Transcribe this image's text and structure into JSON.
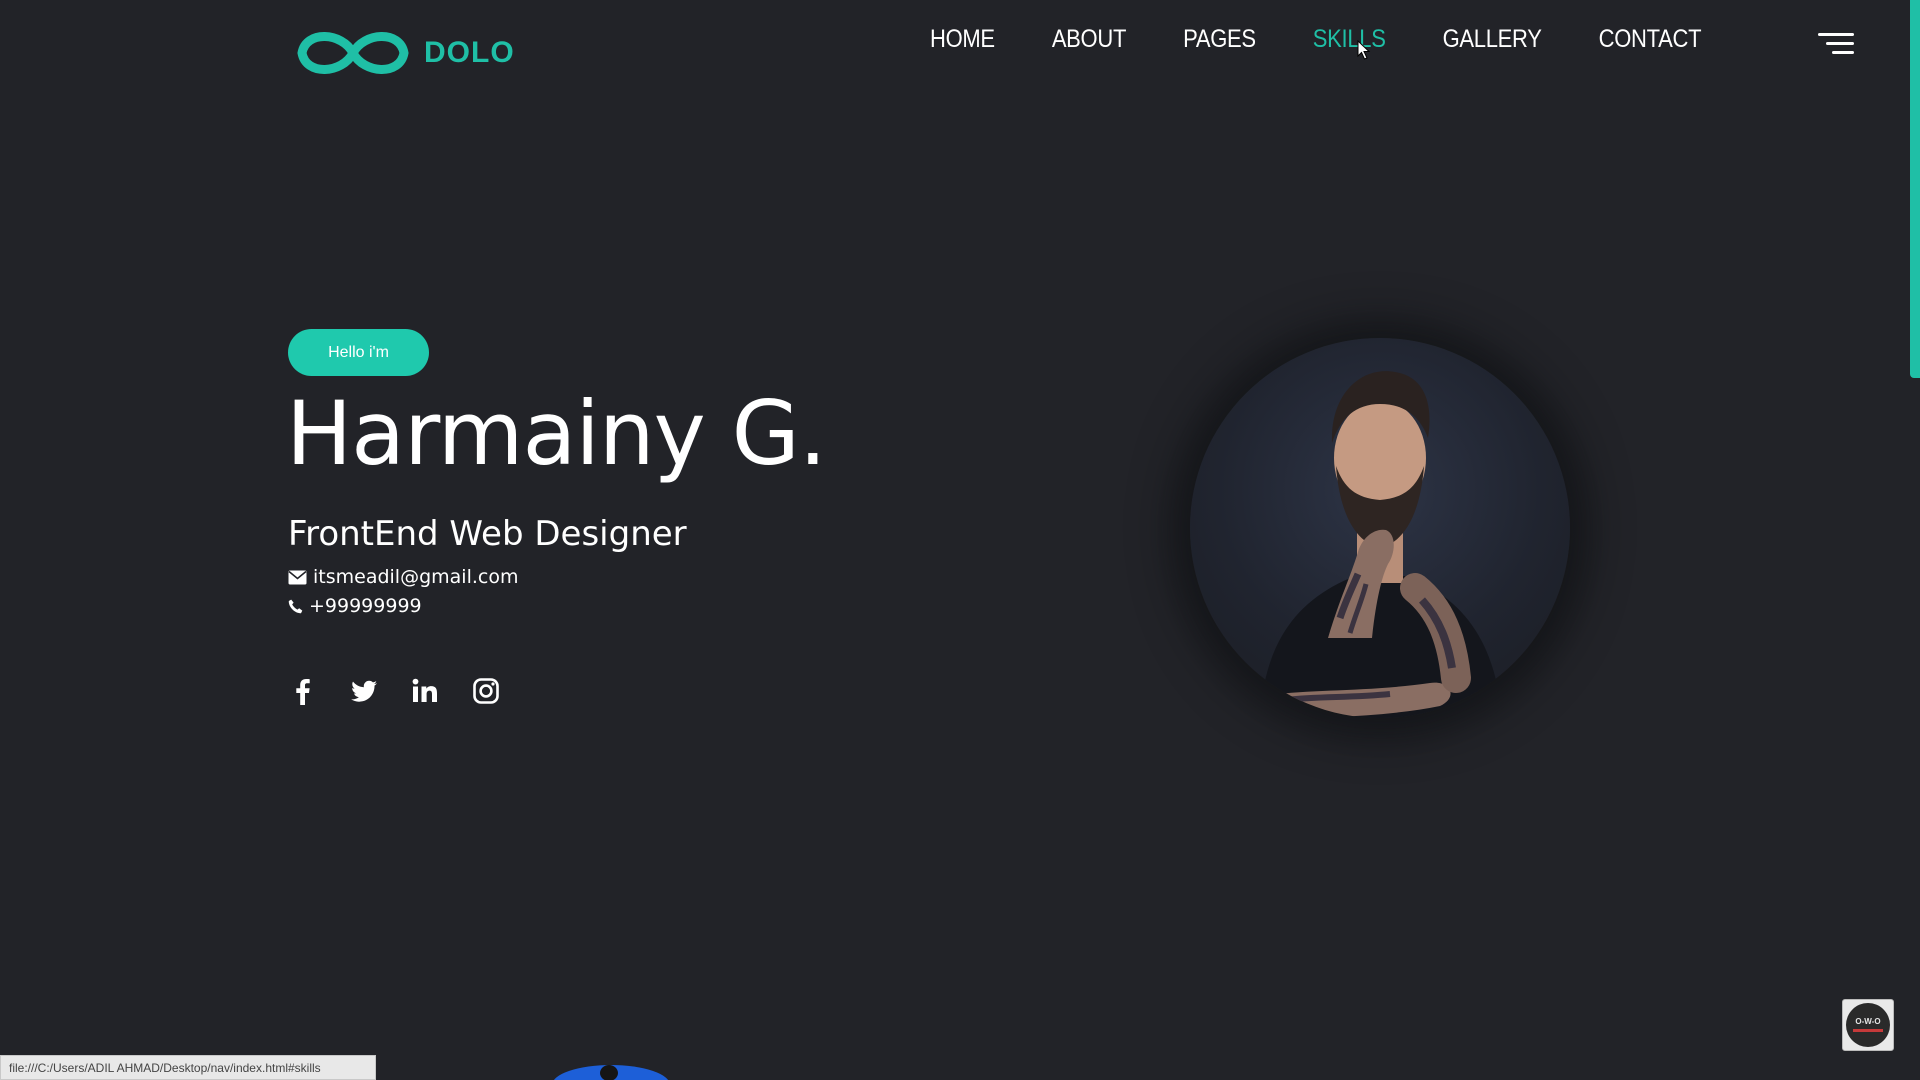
{
  "brand": {
    "name": "DOLO",
    "accent_color": "#1fbfa6",
    "logo_icon": "infinity-icon"
  },
  "nav": {
    "items": [
      {
        "label": "HOME",
        "active": false
      },
      {
        "label": "ABOUT",
        "active": false
      },
      {
        "label": "PAGES",
        "active": false
      },
      {
        "label": "SKILLS",
        "active": true
      },
      {
        "label": "GALLERY",
        "active": false
      },
      {
        "label": "CONTACT",
        "active": false
      }
    ],
    "menu_icon": "hamburger-menu-icon"
  },
  "hero": {
    "badge": "Hello i'm",
    "name": "Harmainy G.",
    "role": "FrontEnd Web Designer",
    "email": "itsmeadil@gmail.com",
    "phone": "+99999999",
    "email_icon": "envelope-icon",
    "phone_icon": "phone-icon",
    "portrait": "portrait-photo"
  },
  "socials": [
    {
      "name": "facebook-icon"
    },
    {
      "name": "twitter-icon"
    },
    {
      "name": "linkedin-icon"
    },
    {
      "name": "instagram-icon"
    }
  ],
  "status_bar": {
    "url": "file:///C:/Users/ADIL AHMAD/Desktop/nav/index.html#skills"
  },
  "colors": {
    "background": "#222328",
    "accent": "#1fbfa6",
    "text": "#ffffff"
  }
}
